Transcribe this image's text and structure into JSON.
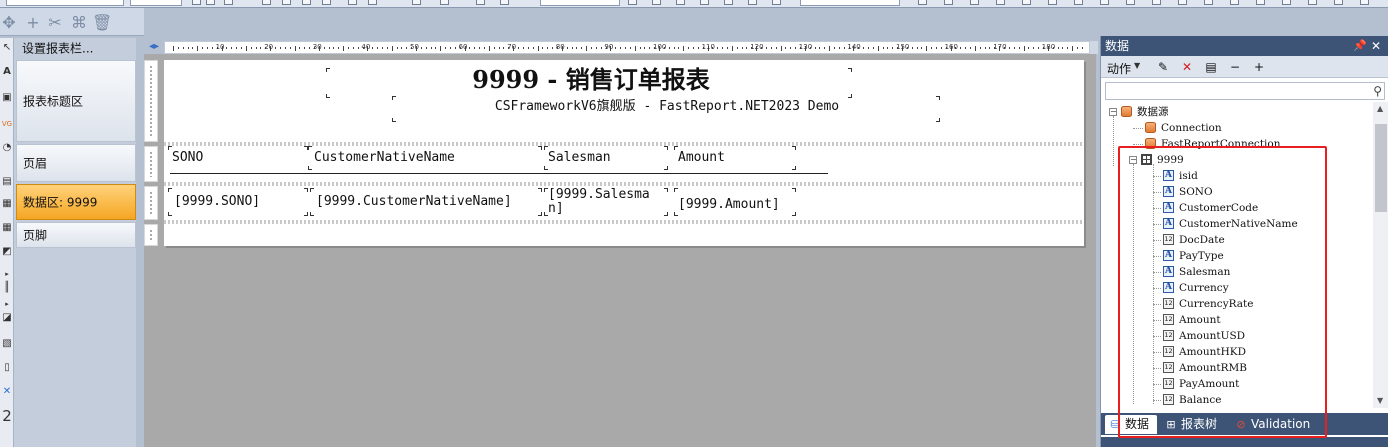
{
  "band_panel": {
    "setup_label": "设置报表栏...",
    "bands": [
      {
        "label": "报表标题区"
      },
      {
        "label": "页眉"
      },
      {
        "label": "数据区: 9999"
      },
      {
        "label": "页脚"
      }
    ]
  },
  "ruler": {
    "marks": [
      "10",
      "20",
      "30",
      "40",
      "50",
      "60",
      "70",
      "80",
      "90",
      "100",
      "110",
      "120",
      "130",
      "140",
      "150",
      "160",
      "170",
      "180",
      "190"
    ]
  },
  "report": {
    "title": "9999 - 销售订单报表",
    "subtitle": "CSFrameworkV6旗舰版 - FastReport.NET2023 Demo",
    "headers": [
      "SONO",
      "CustomerNativeName",
      "Salesman",
      "Amount"
    ],
    "cells": [
      "[9999.SONO]",
      "[9999.CustomerNativeName]",
      "[9999.Salesma\nn]",
      "[9999.Amount]"
    ]
  },
  "data_panel": {
    "title": "数据",
    "pin_icon": "pin-icon",
    "close_icon": "close-icon",
    "action_label": "动作",
    "tree": {
      "root": "数据源",
      "connections": [
        "Connection",
        "FastReportConnection"
      ],
      "table": "9999",
      "fields": [
        {
          "name": "isid",
          "type": "text"
        },
        {
          "name": "SONO",
          "type": "text"
        },
        {
          "name": "CustomerCode",
          "type": "text"
        },
        {
          "name": "CustomerNativeName",
          "type": "text"
        },
        {
          "name": "DocDate",
          "type": "number"
        },
        {
          "name": "PayType",
          "type": "text"
        },
        {
          "name": "Salesman",
          "type": "text"
        },
        {
          "name": "Currency",
          "type": "text"
        },
        {
          "name": "CurrencyRate",
          "type": "number"
        },
        {
          "name": "Amount",
          "type": "number"
        },
        {
          "name": "AmountUSD",
          "type": "number"
        },
        {
          "name": "AmountHKD",
          "type": "number"
        },
        {
          "name": "AmountRMB",
          "type": "number"
        },
        {
          "name": "PayAmount",
          "type": "number"
        },
        {
          "name": "Balance",
          "type": "number"
        }
      ],
      "number_icon_text": "12",
      "text_icon_text": "A"
    },
    "tabs": [
      {
        "label": "数据"
      },
      {
        "label": "报表树"
      },
      {
        "label": "Validation"
      }
    ]
  },
  "colors": {
    "panel_header": "#3d5476",
    "active_band": "#f5a623",
    "highlight": "#e81f1f",
    "canvas_bg": "#a9a9a9"
  }
}
